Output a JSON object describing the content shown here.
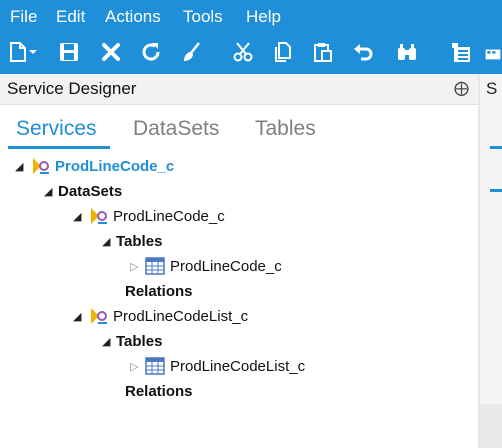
{
  "menu": [
    "File",
    "Edit",
    "Actions",
    "Tools",
    "Help"
  ],
  "toolbar": {
    "icons": [
      "new-icon",
      "save-icon",
      "delete-icon",
      "refresh-icon",
      "clear-icon",
      "cut-icon",
      "copy-icon",
      "paste-icon",
      "undo-icon",
      "find-icon",
      "properties-icon"
    ]
  },
  "panel": {
    "title": "Service Designer",
    "pin": "⨁",
    "right_title": "S"
  },
  "tabs": [
    {
      "label": "Services",
      "active": true
    },
    {
      "label": "DataSets",
      "active": false
    },
    {
      "label": "Tables",
      "active": false
    }
  ],
  "tree": {
    "root": "ProdLineCode_c",
    "datasets": "DataSets",
    "ds1": "ProdLineCode_c",
    "ds1_tables": "Tables",
    "ds1_table": "ProdLineCode_c",
    "ds1_relations": "Relations",
    "ds2": "ProdLineCodeList_c",
    "ds2_tables": "Tables",
    "ds2_table": "ProdLineCodeList_c",
    "ds2_relations": "Relations"
  },
  "colors": {
    "accent": "#1e8fd8"
  }
}
